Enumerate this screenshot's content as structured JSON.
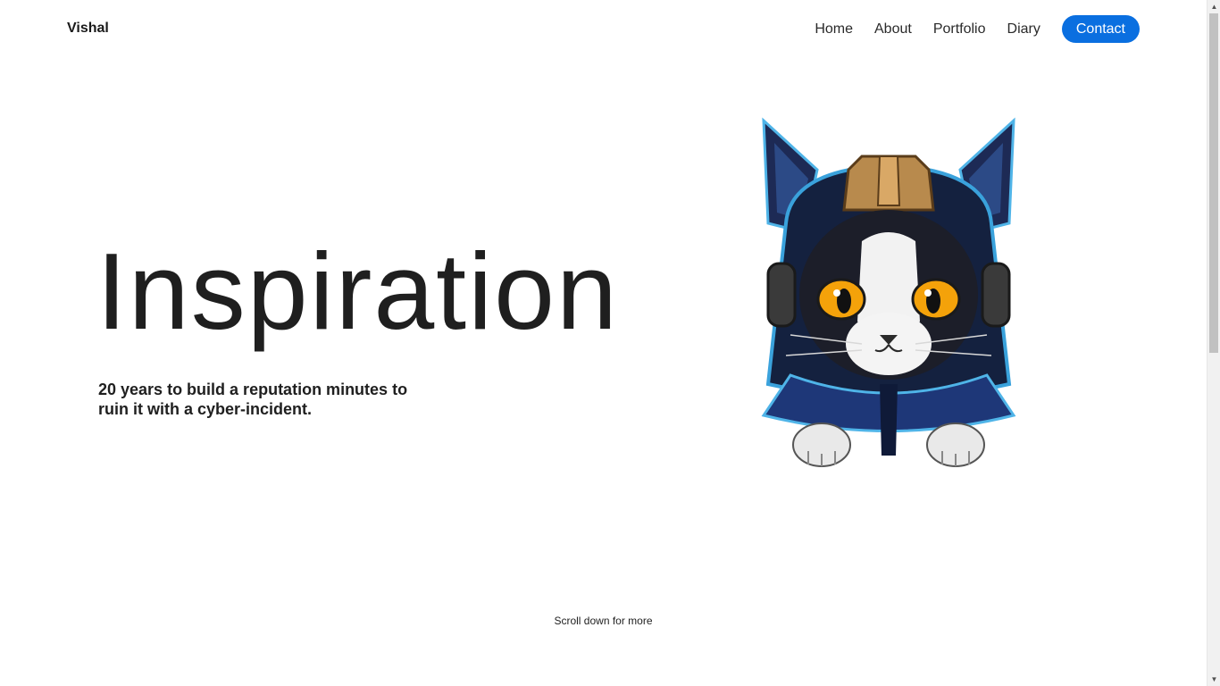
{
  "navbar": {
    "brand": "Vishal",
    "links": [
      {
        "label": "Home"
      },
      {
        "label": "About"
      },
      {
        "label": "Portfolio"
      },
      {
        "label": "Diary"
      }
    ],
    "contact_label": "Contact",
    "accent_color": "#0a6fe0"
  },
  "hero": {
    "title": "Inspiration",
    "subtitle": "20 years to build a reputation minutes to ruin it with a cyber-incident.",
    "image_icon": "cyber-cat-illustration"
  },
  "footer_hint": {
    "text": "Scroll down for more"
  }
}
